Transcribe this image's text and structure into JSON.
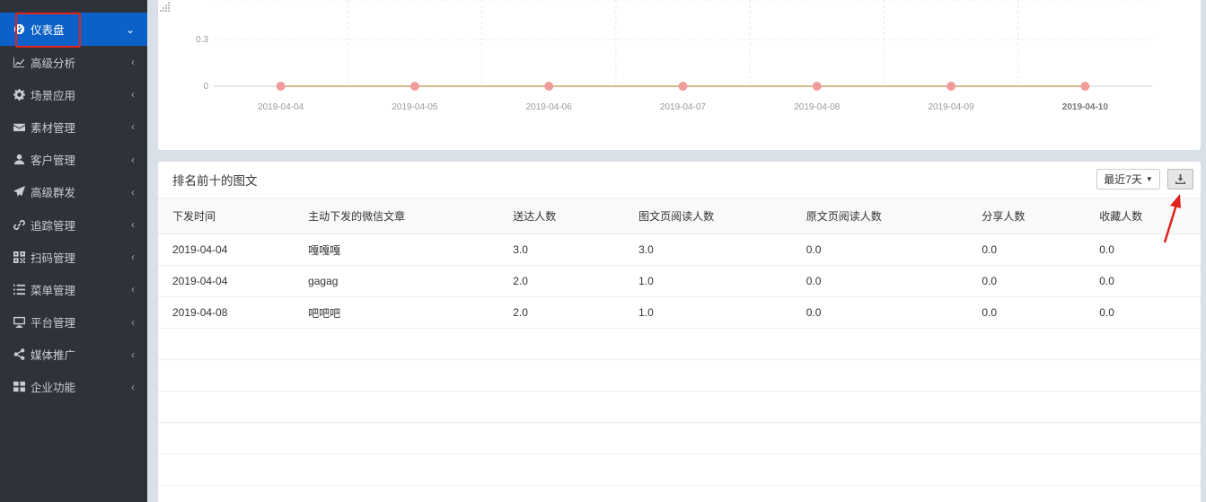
{
  "sidebar": {
    "items": [
      {
        "label": "仪表盘",
        "icon": "dashboard-icon",
        "active": true
      },
      {
        "label": "高级分析",
        "icon": "line-chart-icon"
      },
      {
        "label": "场景应用",
        "icon": "gear-icon"
      },
      {
        "label": "素材管理",
        "icon": "envelope-icon"
      },
      {
        "label": "客户管理",
        "icon": "user-icon"
      },
      {
        "label": "高级群发",
        "icon": "paper-plane-icon"
      },
      {
        "label": "追踪管理",
        "icon": "link-icon"
      },
      {
        "label": "扫码管理",
        "icon": "qrcode-icon"
      },
      {
        "label": "菜单管理",
        "icon": "list-icon"
      },
      {
        "label": "平台管理",
        "icon": "desktop-icon"
      },
      {
        "label": "媒体推广",
        "icon": "share-icon"
      },
      {
        "label": "企业功能",
        "icon": "grid-icon"
      }
    ]
  },
  "chart_data": {
    "type": "line",
    "x": [
      "2019-04-04",
      "2019-04-05",
      "2019-04-06",
      "2019-04-07",
      "2019-04-08",
      "2019-04-09",
      "2019-04-10"
    ],
    "series": [
      {
        "values": [
          0,
          0,
          0,
          0,
          0,
          0,
          0
        ]
      }
    ],
    "y_ticks_visible": [
      "0.3",
      "0"
    ],
    "grid": true,
    "colors": {
      "line": "#c9a36b",
      "point": "#f19b9b"
    }
  },
  "panel": {
    "title": "排名前十的图文",
    "range_label": "最近7天"
  },
  "table": {
    "columns": [
      "下发时间",
      "主动下发的微信文章",
      "送达人数",
      "图文页阅读人数",
      "原文页阅读人数",
      "分享人数",
      "收藏人数"
    ],
    "rows": [
      [
        "2019-04-04",
        "嘎嘎嘎",
        "3.0",
        "3.0",
        "0.0",
        "0.0",
        "0.0"
      ],
      [
        "2019-04-04",
        "gagag",
        "2.0",
        "1.0",
        "0.0",
        "0.0",
        "0.0"
      ],
      [
        "2019-04-08",
        "吧吧吧",
        "2.0",
        "1.0",
        "0.0",
        "0.0",
        "0.0"
      ]
    ]
  },
  "colors": {
    "sidebar_bg": "#2f3339",
    "active_bg": "#0b61c7",
    "annotation_red": "#e0231c"
  }
}
